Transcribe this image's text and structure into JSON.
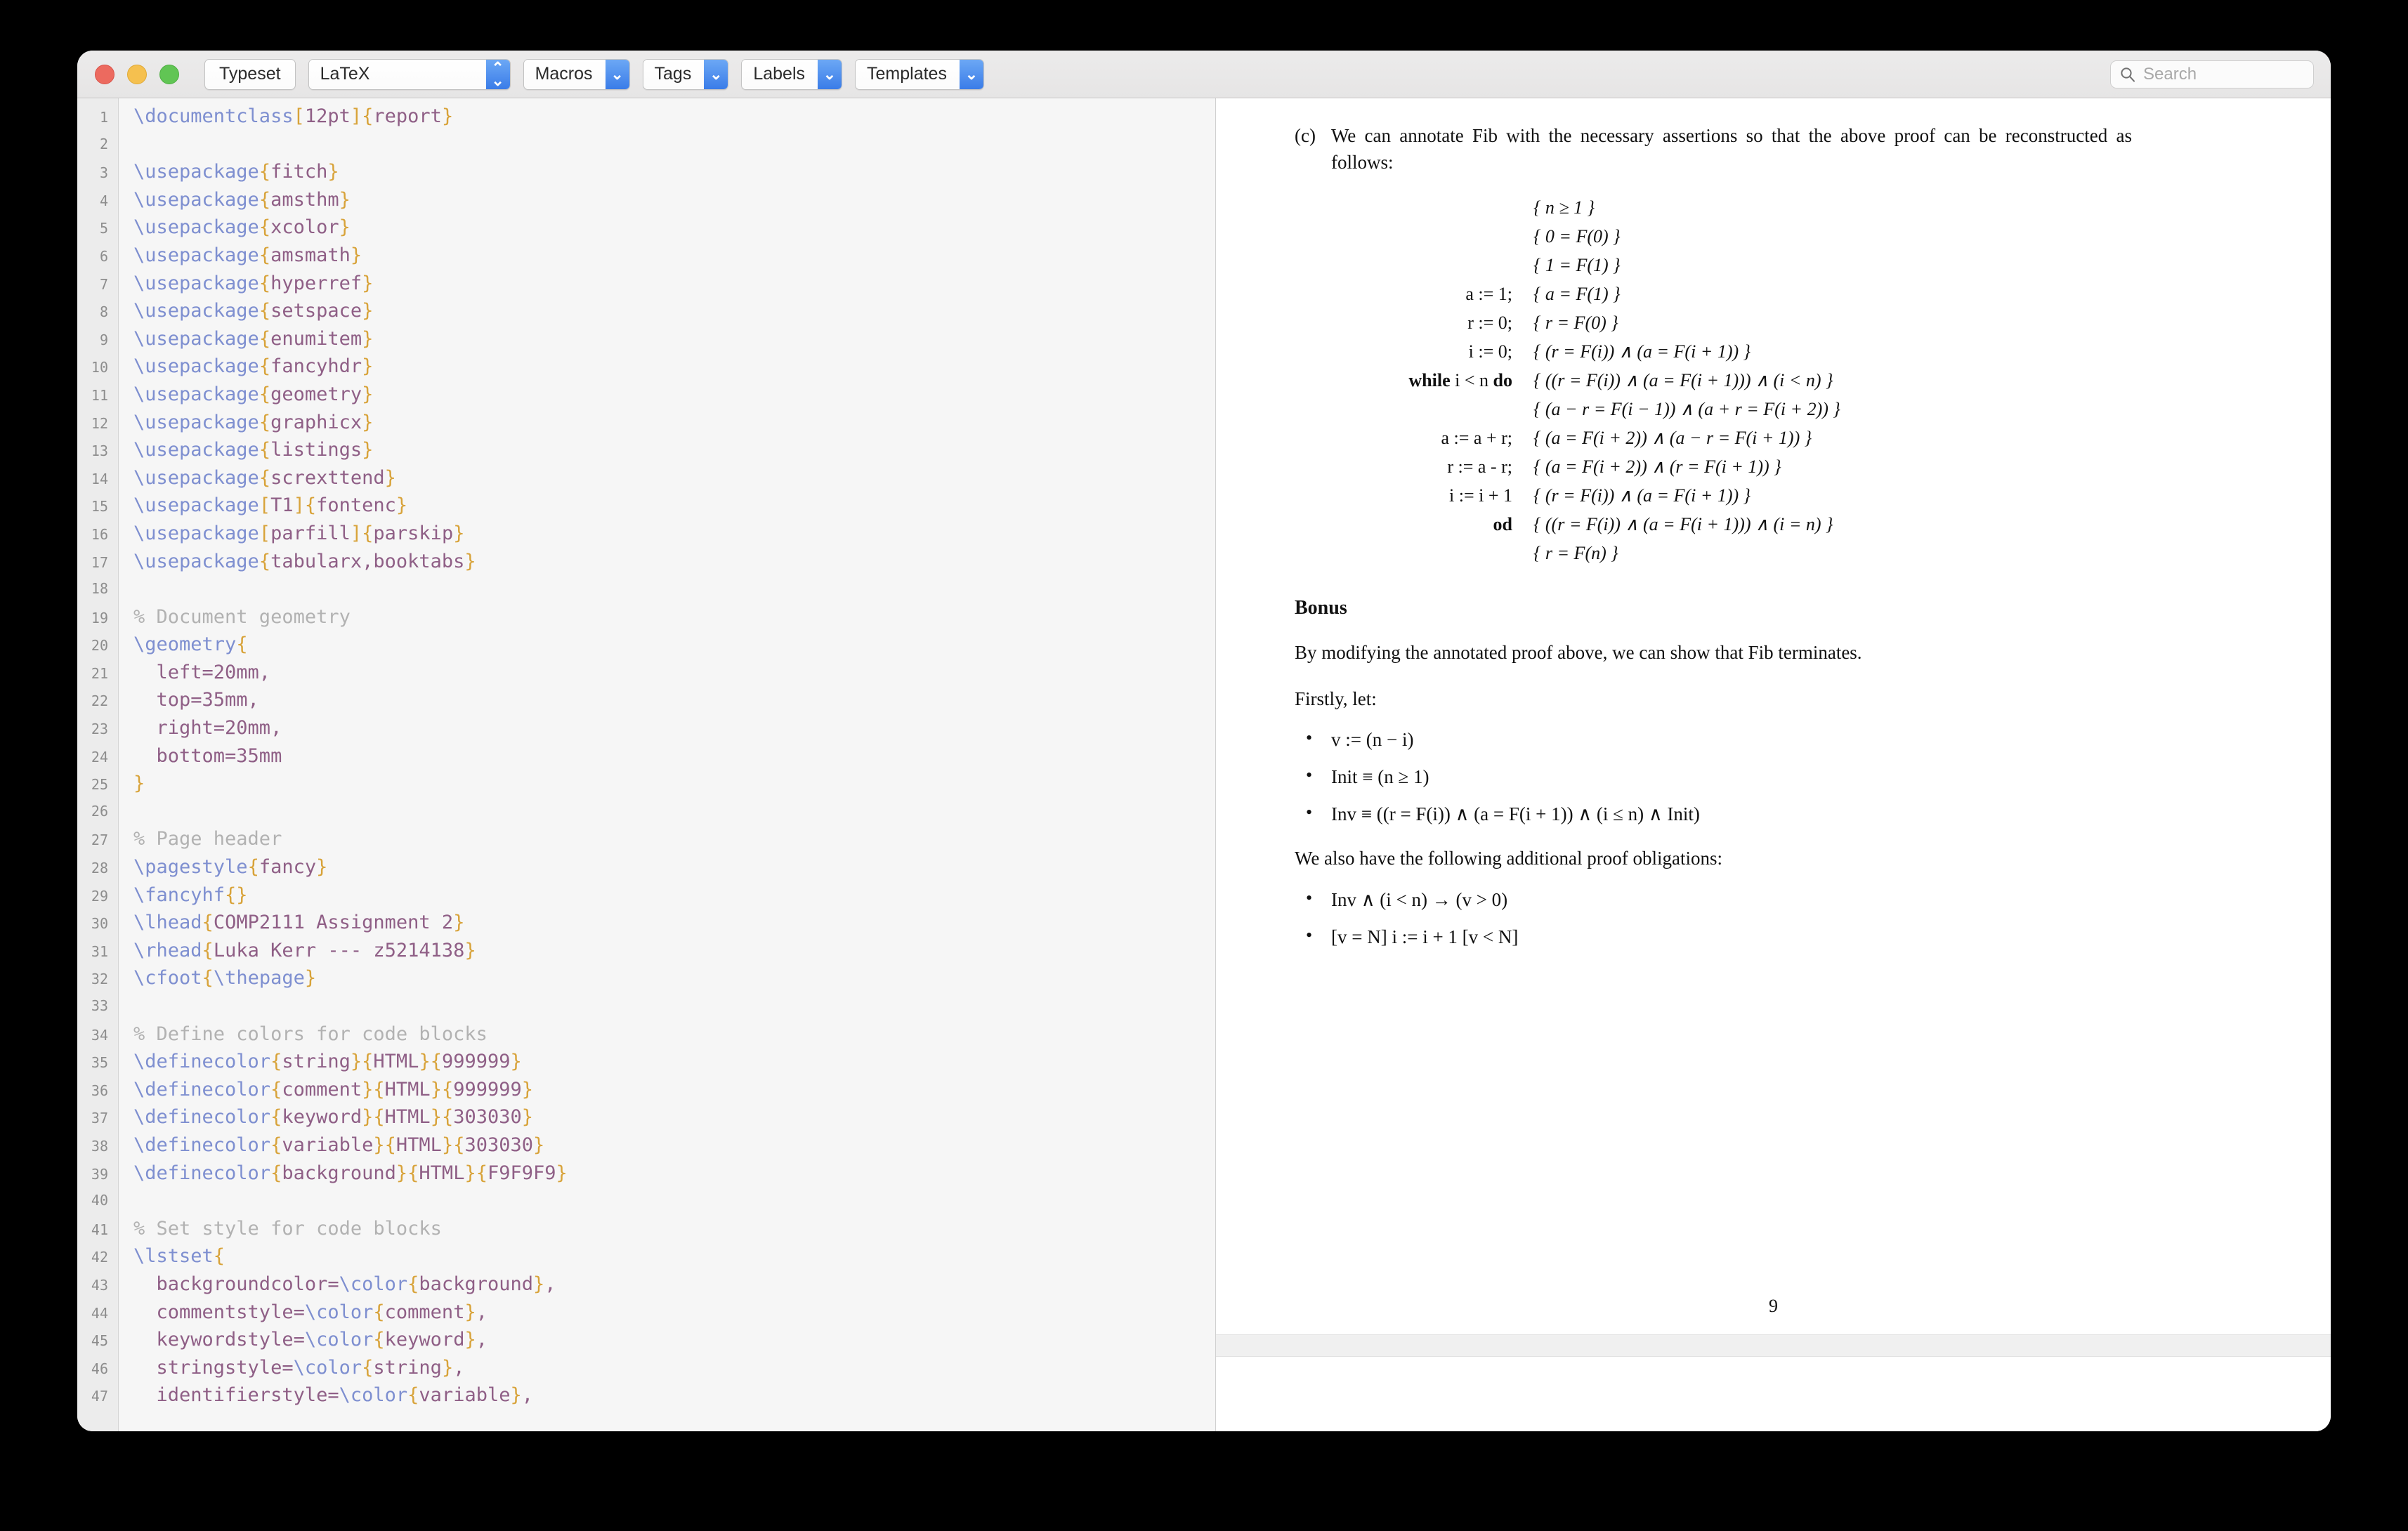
{
  "window": {
    "traffic_lights": [
      "close",
      "minimize",
      "zoom"
    ]
  },
  "toolbar": {
    "typeset_label": "Typeset",
    "engine_label": "LaTeX",
    "macros_label": "Macros",
    "tags_label": "Tags",
    "labels_label": "Labels",
    "templates_label": "Templates",
    "search_placeholder": "Search",
    "accent_blue": "#3a7ce8"
  },
  "editor": {
    "syntax_colors": {
      "command": "#7e8fd0",
      "brace": "#d8a33a",
      "argument": "#8f5f86",
      "comment": "#b2b2b2",
      "background": "#f6f6f6",
      "gutter": "#ececec"
    },
    "lines": [
      {
        "n": 1,
        "tokens": [
          [
            "cmd",
            "\\documentclass"
          ],
          [
            "brace",
            "["
          ],
          [
            "arg",
            "12pt"
          ],
          [
            "brace",
            "]"
          ],
          [
            "brace",
            "{"
          ],
          [
            "arg",
            "report"
          ],
          [
            "brace",
            "}"
          ]
        ]
      },
      {
        "n": 2,
        "tokens": []
      },
      {
        "n": 3,
        "tokens": [
          [
            "cmd",
            "\\usepackage"
          ],
          [
            "brace",
            "{"
          ],
          [
            "arg",
            "fitch"
          ],
          [
            "brace",
            "}"
          ]
        ]
      },
      {
        "n": 4,
        "tokens": [
          [
            "cmd",
            "\\usepackage"
          ],
          [
            "brace",
            "{"
          ],
          [
            "arg",
            "amsthm"
          ],
          [
            "brace",
            "}"
          ]
        ]
      },
      {
        "n": 5,
        "tokens": [
          [
            "cmd",
            "\\usepackage"
          ],
          [
            "brace",
            "{"
          ],
          [
            "arg",
            "xcolor"
          ],
          [
            "brace",
            "}"
          ]
        ]
      },
      {
        "n": 6,
        "tokens": [
          [
            "cmd",
            "\\usepackage"
          ],
          [
            "brace",
            "{"
          ],
          [
            "arg",
            "amsmath"
          ],
          [
            "brace",
            "}"
          ]
        ]
      },
      {
        "n": 7,
        "tokens": [
          [
            "cmd",
            "\\usepackage"
          ],
          [
            "brace",
            "{"
          ],
          [
            "arg",
            "hyperref"
          ],
          [
            "brace",
            "}"
          ]
        ]
      },
      {
        "n": 8,
        "tokens": [
          [
            "cmd",
            "\\usepackage"
          ],
          [
            "brace",
            "{"
          ],
          [
            "arg",
            "setspace"
          ],
          [
            "brace",
            "}"
          ]
        ]
      },
      {
        "n": 9,
        "tokens": [
          [
            "cmd",
            "\\usepackage"
          ],
          [
            "brace",
            "{"
          ],
          [
            "arg",
            "enumitem"
          ],
          [
            "brace",
            "}"
          ]
        ]
      },
      {
        "n": 10,
        "tokens": [
          [
            "cmd",
            "\\usepackage"
          ],
          [
            "brace",
            "{"
          ],
          [
            "arg",
            "fancyhdr"
          ],
          [
            "brace",
            "}"
          ]
        ]
      },
      {
        "n": 11,
        "tokens": [
          [
            "cmd",
            "\\usepackage"
          ],
          [
            "brace",
            "{"
          ],
          [
            "arg",
            "geometry"
          ],
          [
            "brace",
            "}"
          ]
        ]
      },
      {
        "n": 12,
        "tokens": [
          [
            "cmd",
            "\\usepackage"
          ],
          [
            "brace",
            "{"
          ],
          [
            "arg",
            "graphicx"
          ],
          [
            "brace",
            "}"
          ]
        ]
      },
      {
        "n": 13,
        "tokens": [
          [
            "cmd",
            "\\usepackage"
          ],
          [
            "brace",
            "{"
          ],
          [
            "arg",
            "listings"
          ],
          [
            "brace",
            "}"
          ]
        ]
      },
      {
        "n": 14,
        "tokens": [
          [
            "cmd",
            "\\usepackage"
          ],
          [
            "brace",
            "{"
          ],
          [
            "arg",
            "screxttend"
          ],
          [
            "brace",
            "}"
          ]
        ]
      },
      {
        "n": 15,
        "tokens": [
          [
            "cmd",
            "\\usepackage"
          ],
          [
            "brace",
            "["
          ],
          [
            "arg",
            "T1"
          ],
          [
            "brace",
            "]"
          ],
          [
            "brace",
            "{"
          ],
          [
            "arg",
            "fontenc"
          ],
          [
            "brace",
            "}"
          ]
        ]
      },
      {
        "n": 16,
        "tokens": [
          [
            "cmd",
            "\\usepackage"
          ],
          [
            "brace",
            "["
          ],
          [
            "arg",
            "parfill"
          ],
          [
            "brace",
            "]"
          ],
          [
            "brace",
            "{"
          ],
          [
            "arg",
            "parskip"
          ],
          [
            "brace",
            "}"
          ]
        ]
      },
      {
        "n": 17,
        "tokens": [
          [
            "cmd",
            "\\usepackage"
          ],
          [
            "brace",
            "{"
          ],
          [
            "arg",
            "tabularx,booktabs"
          ],
          [
            "brace",
            "}"
          ]
        ]
      },
      {
        "n": 18,
        "tokens": []
      },
      {
        "n": 19,
        "tokens": [
          [
            "cmt",
            "% Document geometry"
          ]
        ]
      },
      {
        "n": 20,
        "tokens": [
          [
            "cmd",
            "\\geometry"
          ],
          [
            "brace",
            "{"
          ]
        ]
      },
      {
        "n": 21,
        "tokens": [
          [
            "plain",
            "  left=20mm,"
          ]
        ]
      },
      {
        "n": 22,
        "tokens": [
          [
            "plain",
            "  top=35mm,"
          ]
        ]
      },
      {
        "n": 23,
        "tokens": [
          [
            "plain",
            "  right=20mm,"
          ]
        ]
      },
      {
        "n": 24,
        "tokens": [
          [
            "plain",
            "  bottom=35mm"
          ]
        ]
      },
      {
        "n": 25,
        "tokens": [
          [
            "brace",
            "}"
          ]
        ]
      },
      {
        "n": 26,
        "tokens": []
      },
      {
        "n": 27,
        "tokens": [
          [
            "cmt",
            "% Page header"
          ]
        ]
      },
      {
        "n": 28,
        "tokens": [
          [
            "cmd",
            "\\pagestyle"
          ],
          [
            "brace",
            "{"
          ],
          [
            "arg",
            "fancy"
          ],
          [
            "brace",
            "}"
          ]
        ]
      },
      {
        "n": 29,
        "tokens": [
          [
            "cmd",
            "\\fancyhf"
          ],
          [
            "brace",
            "{}"
          ]
        ]
      },
      {
        "n": 30,
        "tokens": [
          [
            "cmd",
            "\\lhead"
          ],
          [
            "brace",
            "{"
          ],
          [
            "arg",
            "COMP2111 Assignment 2"
          ],
          [
            "brace",
            "}"
          ]
        ]
      },
      {
        "n": 31,
        "tokens": [
          [
            "cmd",
            "\\rhead"
          ],
          [
            "brace",
            "{"
          ],
          [
            "arg",
            "Luka Kerr --- z5214138"
          ],
          [
            "brace",
            "}"
          ]
        ]
      },
      {
        "n": 32,
        "tokens": [
          [
            "cmd",
            "\\cfoot"
          ],
          [
            "brace",
            "{"
          ],
          [
            "cmd",
            "\\thepage"
          ],
          [
            "brace",
            "}"
          ]
        ]
      },
      {
        "n": 33,
        "tokens": []
      },
      {
        "n": 34,
        "tokens": [
          [
            "cmt",
            "% Define colors for code blocks"
          ]
        ]
      },
      {
        "n": 35,
        "tokens": [
          [
            "cmd",
            "\\definecolor"
          ],
          [
            "brace",
            "{"
          ],
          [
            "arg",
            "string"
          ],
          [
            "brace",
            "}{"
          ],
          [
            "arg",
            "HTML"
          ],
          [
            "brace",
            "}{"
          ],
          [
            "arg",
            "999999"
          ],
          [
            "brace",
            "}"
          ]
        ]
      },
      {
        "n": 36,
        "tokens": [
          [
            "cmd",
            "\\definecolor"
          ],
          [
            "brace",
            "{"
          ],
          [
            "arg",
            "comment"
          ],
          [
            "brace",
            "}{"
          ],
          [
            "arg",
            "HTML"
          ],
          [
            "brace",
            "}{"
          ],
          [
            "arg",
            "999999"
          ],
          [
            "brace",
            "}"
          ]
        ]
      },
      {
        "n": 37,
        "tokens": [
          [
            "cmd",
            "\\definecolor"
          ],
          [
            "brace",
            "{"
          ],
          [
            "arg",
            "keyword"
          ],
          [
            "brace",
            "}{"
          ],
          [
            "arg",
            "HTML"
          ],
          [
            "brace",
            "}{"
          ],
          [
            "arg",
            "303030"
          ],
          [
            "brace",
            "}"
          ]
        ]
      },
      {
        "n": 38,
        "tokens": [
          [
            "cmd",
            "\\definecolor"
          ],
          [
            "brace",
            "{"
          ],
          [
            "arg",
            "variable"
          ],
          [
            "brace",
            "}{"
          ],
          [
            "arg",
            "HTML"
          ],
          [
            "brace",
            "}{"
          ],
          [
            "arg",
            "303030"
          ],
          [
            "brace",
            "}"
          ]
        ]
      },
      {
        "n": 39,
        "tokens": [
          [
            "cmd",
            "\\definecolor"
          ],
          [
            "brace",
            "{"
          ],
          [
            "arg",
            "background"
          ],
          [
            "brace",
            "}{"
          ],
          [
            "arg",
            "HTML"
          ],
          [
            "brace",
            "}{"
          ],
          [
            "arg",
            "F9F9F9"
          ],
          [
            "brace",
            "}"
          ]
        ]
      },
      {
        "n": 40,
        "tokens": []
      },
      {
        "n": 41,
        "tokens": [
          [
            "cmt",
            "% Set style for code blocks"
          ]
        ]
      },
      {
        "n": 42,
        "tokens": [
          [
            "cmd",
            "\\lstset"
          ],
          [
            "brace",
            "{"
          ]
        ]
      },
      {
        "n": 43,
        "tokens": [
          [
            "plain",
            "  backgroundcolor="
          ],
          [
            "cmd",
            "\\color"
          ],
          [
            "brace",
            "{"
          ],
          [
            "arg",
            "background"
          ],
          [
            "brace",
            "}"
          ],
          [
            "plain",
            ","
          ]
        ]
      },
      {
        "n": 44,
        "tokens": [
          [
            "plain",
            "  commentstyle="
          ],
          [
            "cmd",
            "\\color"
          ],
          [
            "brace",
            "{"
          ],
          [
            "arg",
            "comment"
          ],
          [
            "brace",
            "}"
          ],
          [
            "plain",
            ","
          ]
        ]
      },
      {
        "n": 45,
        "tokens": [
          [
            "plain",
            "  keywordstyle="
          ],
          [
            "cmd",
            "\\color"
          ],
          [
            "brace",
            "{"
          ],
          [
            "arg",
            "keyword"
          ],
          [
            "brace",
            "}"
          ],
          [
            "plain",
            ","
          ]
        ]
      },
      {
        "n": 46,
        "tokens": [
          [
            "plain",
            "  stringstyle="
          ],
          [
            "cmd",
            "\\color"
          ],
          [
            "brace",
            "{"
          ],
          [
            "arg",
            "string"
          ],
          [
            "brace",
            "}"
          ],
          [
            "plain",
            ","
          ]
        ]
      },
      {
        "n": 47,
        "tokens": [
          [
            "plain",
            "  identifierstyle="
          ],
          [
            "cmd",
            "\\color"
          ],
          [
            "brace",
            "{"
          ],
          [
            "arg",
            "variable"
          ],
          [
            "brace",
            "}"
          ],
          [
            "plain",
            ","
          ]
        ]
      }
    ]
  },
  "preview": {
    "item_c_marker": "(c)",
    "item_c_text": "We can annotate Fib with the necessary assertions so that the above proof can be reconstructed as follows:",
    "annotated_program": [
      {
        "code": "",
        "assertion": "{ n ≥ 1 }"
      },
      {
        "code": "",
        "assertion": "{ 0 = F(0) }"
      },
      {
        "code": "",
        "assertion": "{ 1 = F(1) }"
      },
      {
        "code": "a := 1;",
        "assertion": "{ a = F(1) }"
      },
      {
        "code": "r := 0;",
        "assertion": "{ r = F(0) }"
      },
      {
        "code": "i := 0;",
        "assertion": "{ (r = F(i)) ∧ (a = F(i + 1)) }"
      },
      {
        "code": "while i < n do",
        "assertion": "{ ((r = F(i)) ∧ (a = F(i + 1))) ∧ (i < n) }"
      },
      {
        "code": "",
        "assertion": "{ (a − r = F(i − 1)) ∧ (a + r = F(i + 2)) }"
      },
      {
        "code": "a := a + r;",
        "assertion": "{ (a = F(i + 2)) ∧ (a − r = F(i + 1)) }"
      },
      {
        "code": "r := a - r;",
        "assertion": "{ (a = F(i + 2)) ∧ (r = F(i + 1)) }"
      },
      {
        "code": "i := i + 1",
        "assertion": "{ (r = F(i)) ∧ (a = F(i + 1)) }"
      },
      {
        "code": "od",
        "assertion": "{ ((r = F(i)) ∧ (a = F(i + 1))) ∧ (i = n) }"
      },
      {
        "code": "",
        "assertion": "{ r = F(n) }"
      }
    ],
    "bonus_heading": "Bonus",
    "bonus_para_1": "By modifying the annotated proof above, we can show that Fib terminates.",
    "bonus_para_2": "Firstly, let:",
    "definitions": [
      "v := (n − i)",
      "Init ≡ (n ≥ 1)",
      "Inv ≡ ((r = F(i)) ∧ (a = F(i + 1)) ∧ (i ≤ n) ∧ Init)"
    ],
    "obligations_intro": "We also have the following additional proof obligations:",
    "obligations": [
      "Inv ∧ (i < n)  →  (v > 0)",
      "[v = N] i := i + 1 [v < N]"
    ],
    "page_number": "9"
  }
}
